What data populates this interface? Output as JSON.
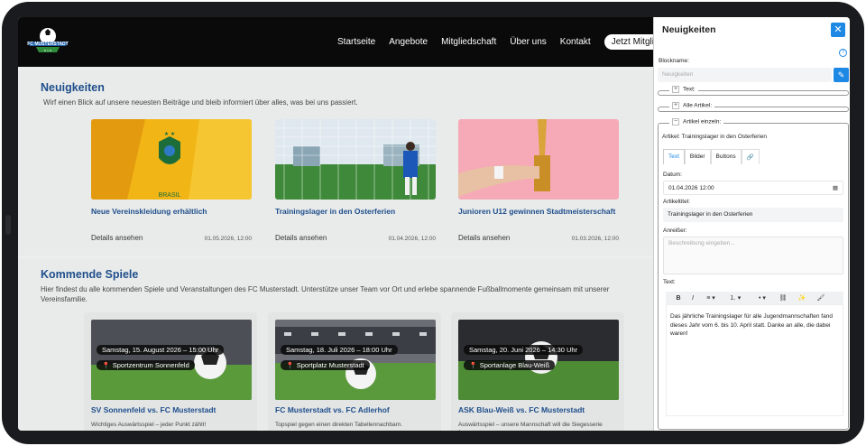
{
  "header": {
    "logo_alt": "FC MUSTERSTADT",
    "nav": [
      "Startseite",
      "Angebote",
      "Mitgliedschaft",
      "Über uns",
      "Kontakt"
    ],
    "cta": "Jetzt Mitglied"
  },
  "news": {
    "title": "Neuigkeiten",
    "description": "Wirf einen Blick auf unsere neuesten Beiträge und bleib informiert über alles, was bei uns passiert.",
    "items": [
      {
        "title": "Neue Vereinskleidung erhältlich",
        "details": "Details ansehen",
        "date": "01.05.2026, 12:00"
      },
      {
        "title": "Trainingslager in den Osterferien",
        "details": "Details ansehen",
        "date": "01.04.2026, 12:00"
      },
      {
        "title": "Junioren U12 gewinnen Stadtmeisterschaft",
        "details": "Details ansehen",
        "date": "01.03.2026, 12:00"
      }
    ]
  },
  "games": {
    "title": "Kommende Spiele",
    "description": "Hier findest du alle kommenden Spiele und Veranstaltungen des FC Musterstadt. Unterstütze unser Team vor Ort und erlebe spannende Fußballmomente gemeinsam mit unserer Vereinsfamilie.",
    "items": [
      {
        "date": "Samstag, 15. August 2026 – 15:00 Uhr",
        "venue": "Sportzentrum Sonnenfeld",
        "title": "SV Sonnenfeld vs. FC Musterstadt",
        "desc": "Wichtiges Auswärtsspiel – jeder Punkt zählt!"
      },
      {
        "date": "Samstag, 18. Juli 2026 – 18:00 Uhr",
        "venue": "Sportplatz Musterstadt",
        "title": "FC Musterstadt vs. FC Adlerhof",
        "desc": "Topspiel gegen einen direkten Tabellennachbarn."
      },
      {
        "date": "Samstag, 20. Juni 2026 – 14:30 Uhr",
        "venue": "Sportanlage Blau-Weiß",
        "title": "ASK Blau-Weiß vs. FC Musterstadt",
        "desc": "Auswärtsspiel – unsere Mannschaft will die Siegesserie fortsetzen."
      }
    ]
  },
  "panel": {
    "title": "Neuigkeiten",
    "close": "✕",
    "blockname_label": "Blockname:",
    "blockname_placeholder": "Neuigkeiten",
    "text_group": "Text:",
    "all_articles_group": "Alle Artikel:",
    "single_article_group": "Artikel einzeln:",
    "article_label": "Artikel: Trainingslager in den Osterferien",
    "tabs": [
      "Text",
      "Bilder",
      "Buttons"
    ],
    "date_label": "Datum:",
    "date_value": "01.04.2026 12:00",
    "article_title_label": "Artikeltitel:",
    "article_title_value": "Trainingslager in den Osterferien",
    "teaser_label": "Anreißer:",
    "teaser_placeholder": "Beschreibung eingeben...",
    "text_label": "Text:",
    "editor_text": "Das jährliche Trainingslager für alle Jugendmannschaften fand dieses Jahr vom 6. bis 10. April statt. Danke an alle, die dabei waren!"
  },
  "colors": {
    "accent": "#1e88e5",
    "heading": "#1f4e8c",
    "header_bg": "#0a0a0a"
  }
}
